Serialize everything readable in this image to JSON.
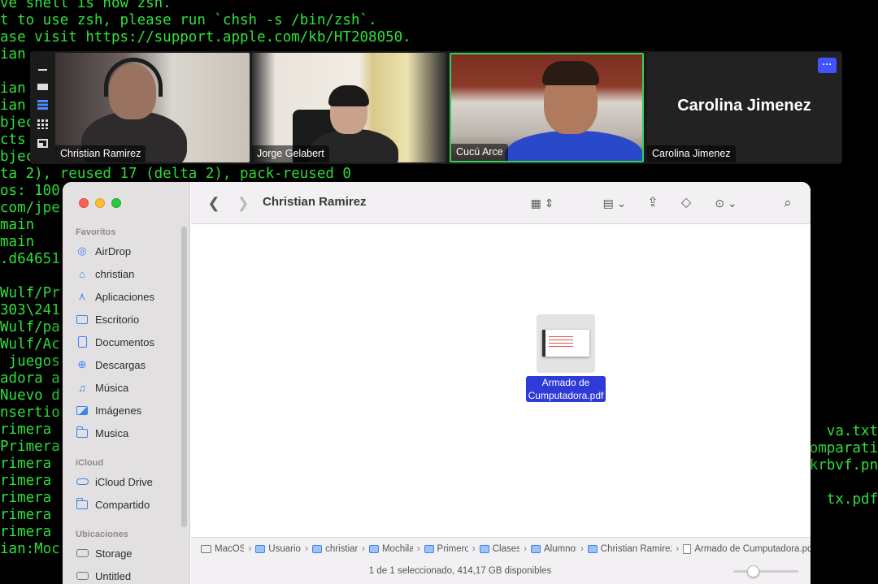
{
  "terminal": {
    "lines": [
      "ve shell is now zsh.",
      "t to use zsh, please run `chsh -s /bin/zsh`.",
      "ase visit https://support.apple.com/kb/HT208050.",
      "ian",
      "",
      "ian",
      "ian",
      "bjec",
      "cts",
      "bjec",
      "ta 2), reused 17 (delta 2), pack-reused 0",
      "os: 100",
      "com/jpe",
      "main",
      "main",
      ".d64651",
      "",
      "Wulf/Pr",
      "303\\241",
      "Wulf/pa",
      "Wulf/Ac",
      " juegos",
      "adora a",
      "Nuevo d",
      "nsertio",
      "rimera",
      "Primera",
      "rimera",
      "rimera",
      "rimera",
      "rimera",
      "rimera",
      "ian:Moc"
    ],
    "right_fragments": [
      {
        "text": "va.txt",
        "row": 25
      },
      {
        "text": "omparati",
        "row": 26
      },
      {
        "text": "krbvf.pn",
        "row": 27
      },
      {
        "text": "tx.pdf",
        "row": 29
      }
    ]
  },
  "zoom": {
    "participants": [
      {
        "name": "Christian Ramirez",
        "active": false
      },
      {
        "name": "Jorge Gelabert",
        "active": false
      },
      {
        "name": "Cucú Arce",
        "active": true
      },
      {
        "name": "Carolina Jimenez",
        "active": false
      }
    ],
    "no_video_label": "Carolina Jimenez",
    "more_label": "···"
  },
  "finder": {
    "title": "Christian Ramirez",
    "sidebar": {
      "favorites_header": "Favoritos",
      "favorites": [
        {
          "label": "AirDrop",
          "icon": "airdrop-icon"
        },
        {
          "label": "christian",
          "icon": "home-icon"
        },
        {
          "label": "Aplicaciones",
          "icon": "applications-icon"
        },
        {
          "label": "Escritorio",
          "icon": "desktop-icon"
        },
        {
          "label": "Documentos",
          "icon": "document-icon"
        },
        {
          "label": "Descargas",
          "icon": "download-icon"
        },
        {
          "label": "Música",
          "icon": "music-icon"
        },
        {
          "label": "Imágenes",
          "icon": "pictures-icon"
        },
        {
          "label": "Musica",
          "icon": "folder-icon"
        }
      ],
      "icloud_header": "iCloud",
      "icloud": [
        {
          "label": "iCloud Drive",
          "icon": "icloud-icon"
        },
        {
          "label": "Compartido",
          "icon": "shared-folder-icon"
        }
      ],
      "locations_header": "Ubicaciones",
      "locations": [
        {
          "label": "Storage",
          "icon": "disk-icon"
        },
        {
          "label": "Untitled",
          "icon": "disk-icon"
        }
      ]
    },
    "file": {
      "label_line1": "Armado de",
      "label_line2": "Cumputadora.pdf"
    },
    "path": [
      {
        "label": "MacOS",
        "icon": "disk-icon"
      },
      {
        "label": "Usuarios",
        "icon": "folder-icon"
      },
      {
        "label": "christian",
        "icon": "home-folder-icon"
      },
      {
        "label": "Mochila",
        "icon": "folder-icon"
      },
      {
        "label": "Primero",
        "icon": "folder-icon"
      },
      {
        "label": "Clases",
        "icon": "folder-icon"
      },
      {
        "label": "Alumnos",
        "icon": "folder-icon"
      },
      {
        "label": "Christian Ramirez",
        "icon": "folder-icon"
      },
      {
        "label": "Armado de Cumputadora.pdf",
        "icon": "pdf-icon"
      }
    ],
    "status": "1 de 1 seleccionado, 414,17 GB disponibles",
    "icon_size_level": 0.3
  }
}
